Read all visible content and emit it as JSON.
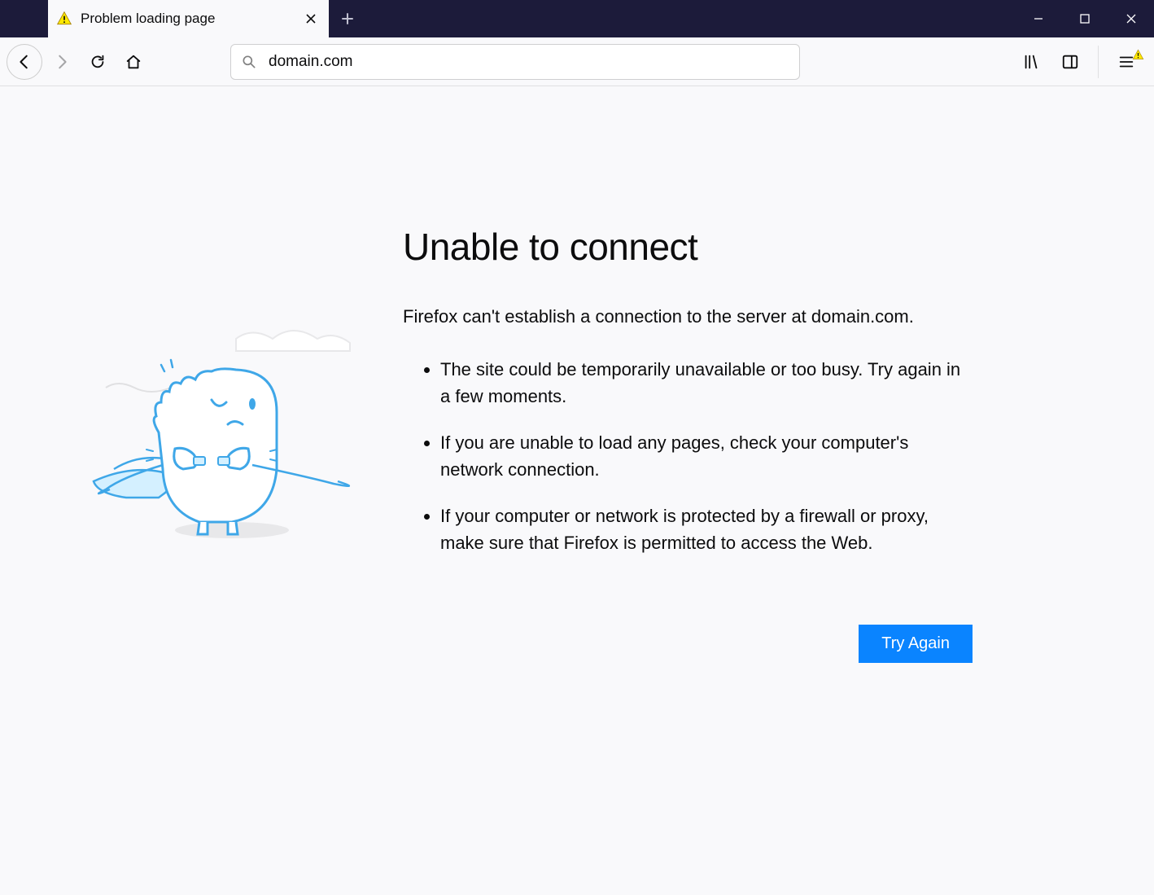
{
  "tab": {
    "title": "Problem loading page"
  },
  "url": {
    "value": "domain.com"
  },
  "error": {
    "title": "Unable to connect",
    "description": "Firefox can't establish a connection to the server at domain.com.",
    "bullets": [
      "The site could be temporarily unavailable or too busy. Try again in a few moments.",
      "If you are unable to load any pages, check your computer's network connection.",
      "If your computer or network is protected by a firewall or proxy, make sure that Firefox is permitted to access the Web."
    ],
    "try_again_label": "Try Again"
  }
}
